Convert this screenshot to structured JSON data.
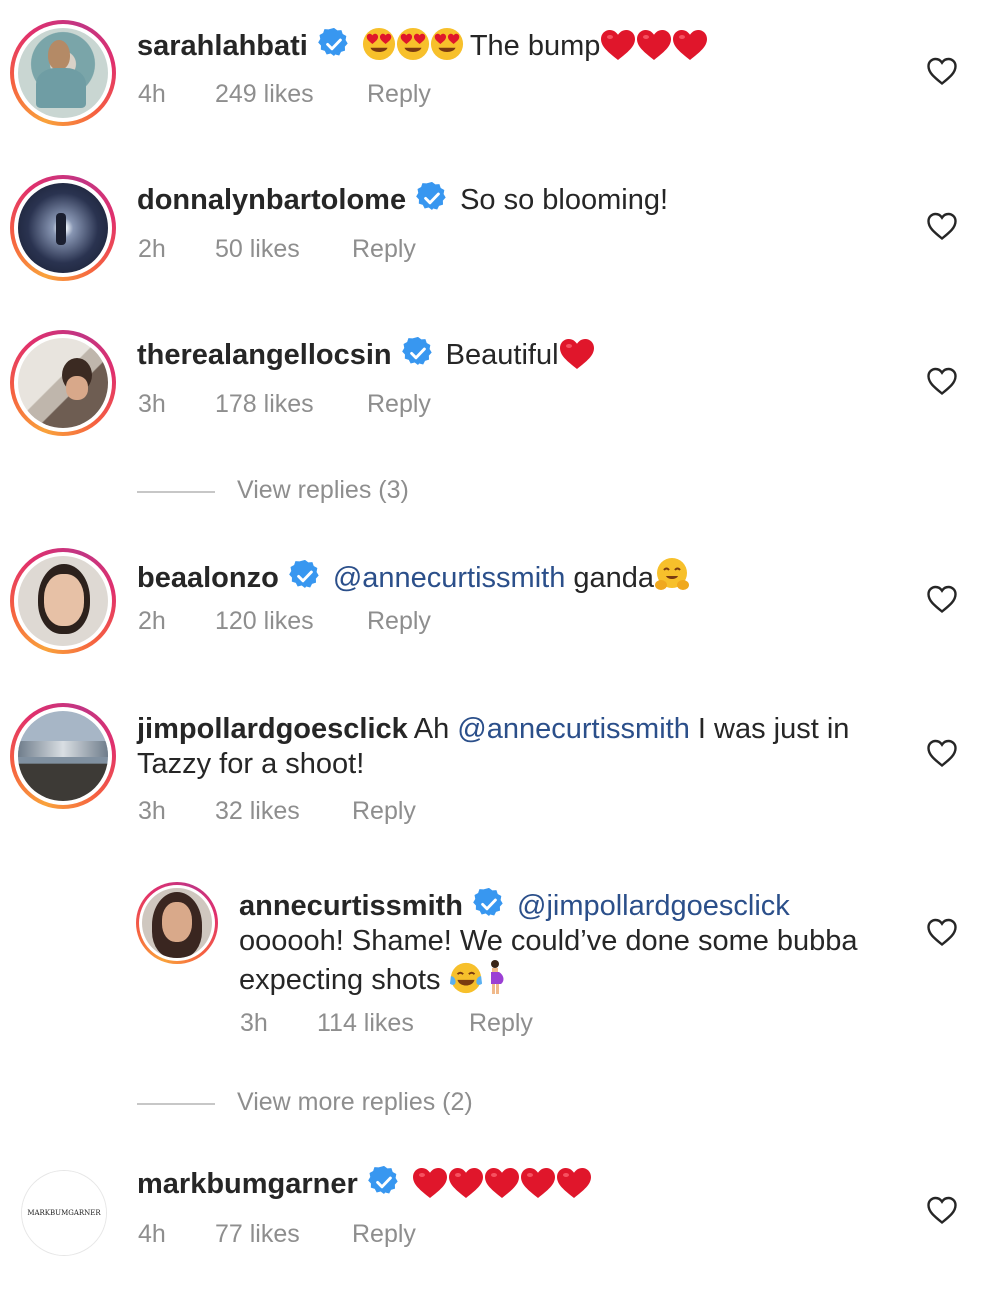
{
  "colors": {
    "text": "#262626",
    "muted": "#8e8e8e",
    "mention": "#2b4f8a",
    "verified_blue": "#3897f0",
    "heart_red": "#e0162b"
  },
  "icons": {
    "verified": "verified-badge-icon",
    "like": "heart-outline-icon",
    "emoji_heart_eyes": "heart-eyes-emoji",
    "emoji_red_heart": "red-heart-emoji",
    "emoji_hugging": "hugging-face-emoji",
    "emoji_joy": "tears-of-joy-emoji",
    "emoji_pregnant": "pregnant-woman-emoji"
  },
  "comments": [
    {
      "username": "sarahlahbati",
      "text": "The bump",
      "time": "4h",
      "likes": "249 likes",
      "reply": "Reply"
    },
    {
      "username": "donnalynbartolome",
      "text": "So so blooming!",
      "time": "2h",
      "likes": "50 likes",
      "reply": "Reply"
    },
    {
      "username": "therealangellocsin",
      "text": "Beautiful",
      "time": "3h",
      "likes": "178 likes",
      "reply": "Reply"
    },
    {
      "username": "beaalonzo",
      "mention": "@annecurtissmith",
      "text": " ganda",
      "time": "2h",
      "likes": "120 likes",
      "reply": "Reply"
    },
    {
      "username": "jimpollardgoesclick",
      "text_before": "Ah ",
      "mention": "@annecurtissmith",
      "text_after": " I was just in",
      "text_line2": "Tazzy for a shoot!",
      "time": "3h",
      "likes": "32 likes",
      "reply": "Reply"
    },
    {
      "username": "markbumgarner",
      "avatar_text": "MARKBUMGARNER",
      "time": "4h",
      "likes": "77 likes",
      "reply": "Reply"
    }
  ],
  "view_replies_1": "View replies (3)",
  "nested_reply": {
    "username": "annecurtissmith",
    "mention": "@jimpollardgoesclick",
    "line2": "oooooh! Shame! We could’ve done some bubba",
    "line3": "expecting shots ",
    "time": "3h",
    "likes": "114 likes",
    "reply": "Reply"
  },
  "view_replies_2": "View more replies (2)"
}
